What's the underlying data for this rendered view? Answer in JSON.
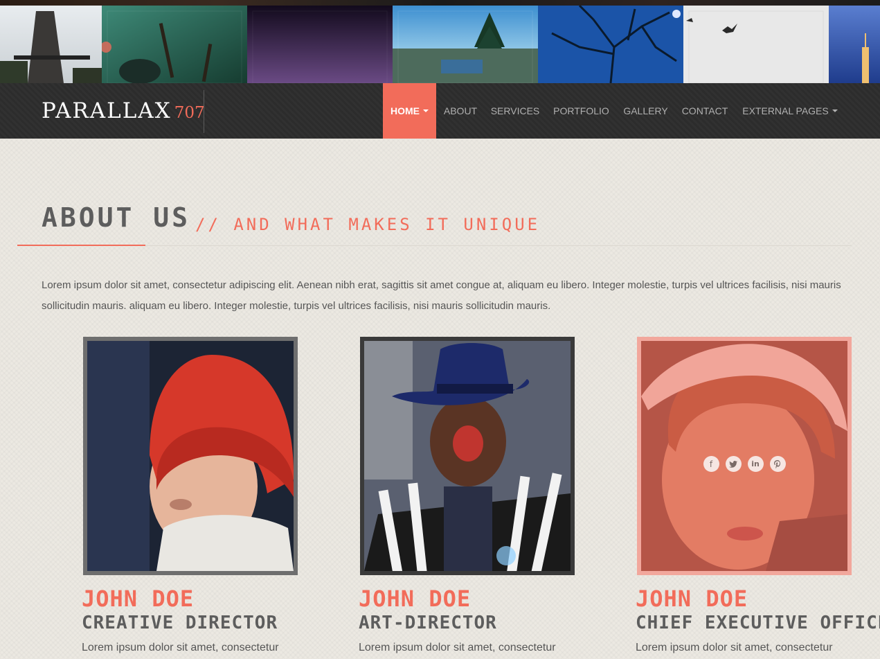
{
  "brand": {
    "name": "PARALLAX",
    "number": "707"
  },
  "nav": {
    "items": [
      {
        "label": "HOME",
        "active": true,
        "dropdown": true
      },
      {
        "label": "ABOUT",
        "active": false,
        "dropdown": false
      },
      {
        "label": "SERVICES",
        "active": false,
        "dropdown": false
      },
      {
        "label": "PORTFOLIO",
        "active": false,
        "dropdown": false
      },
      {
        "label": "GALLERY",
        "active": false,
        "dropdown": false
      },
      {
        "label": "CONTACT",
        "active": false,
        "dropdown": false
      },
      {
        "label": "EXTERNAL PAGES",
        "active": false,
        "dropdown": true
      }
    ]
  },
  "about": {
    "title": "ABOUT US",
    "subtitle": "// AND WHAT MAKES IT UNIQUE",
    "intro": "Lorem ipsum dolor sit amet, consectetur adipiscing elit. Aenean nibh erat, sagittis sit amet congue at, aliquam eu libero. Integer molestie, turpis vel ultrices facilisis, nisi mauris sollicitudin mauris. aliquam eu libero. Integer molestie, turpis vel ultrices facilisis, nisi mauris sollicitudin mauris."
  },
  "team": [
    {
      "name": "JOHN DOE",
      "role": "CREATIVE DIRECTOR",
      "bio": "Lorem ipsum dolor sit amet, consectetur"
    },
    {
      "name": "JOHN DOE",
      "role": "ART-DIRECTOR",
      "bio": "Lorem ipsum dolor sit amet, consectetur"
    },
    {
      "name": "JOHN DOE",
      "role": "CHIEF EXECUTIVE OFFICER",
      "bio": "Lorem ipsum dolor sit amet, consectetur",
      "social": [
        "facebook-icon",
        "twitter-icon",
        "linkedin-icon",
        "pinterest-icon"
      ]
    }
  ],
  "colors": {
    "accent": "#f26c5a",
    "nav_bg": "#2c2c2c",
    "heading": "#5d5d5d",
    "page_bg": "#ece9e2"
  }
}
